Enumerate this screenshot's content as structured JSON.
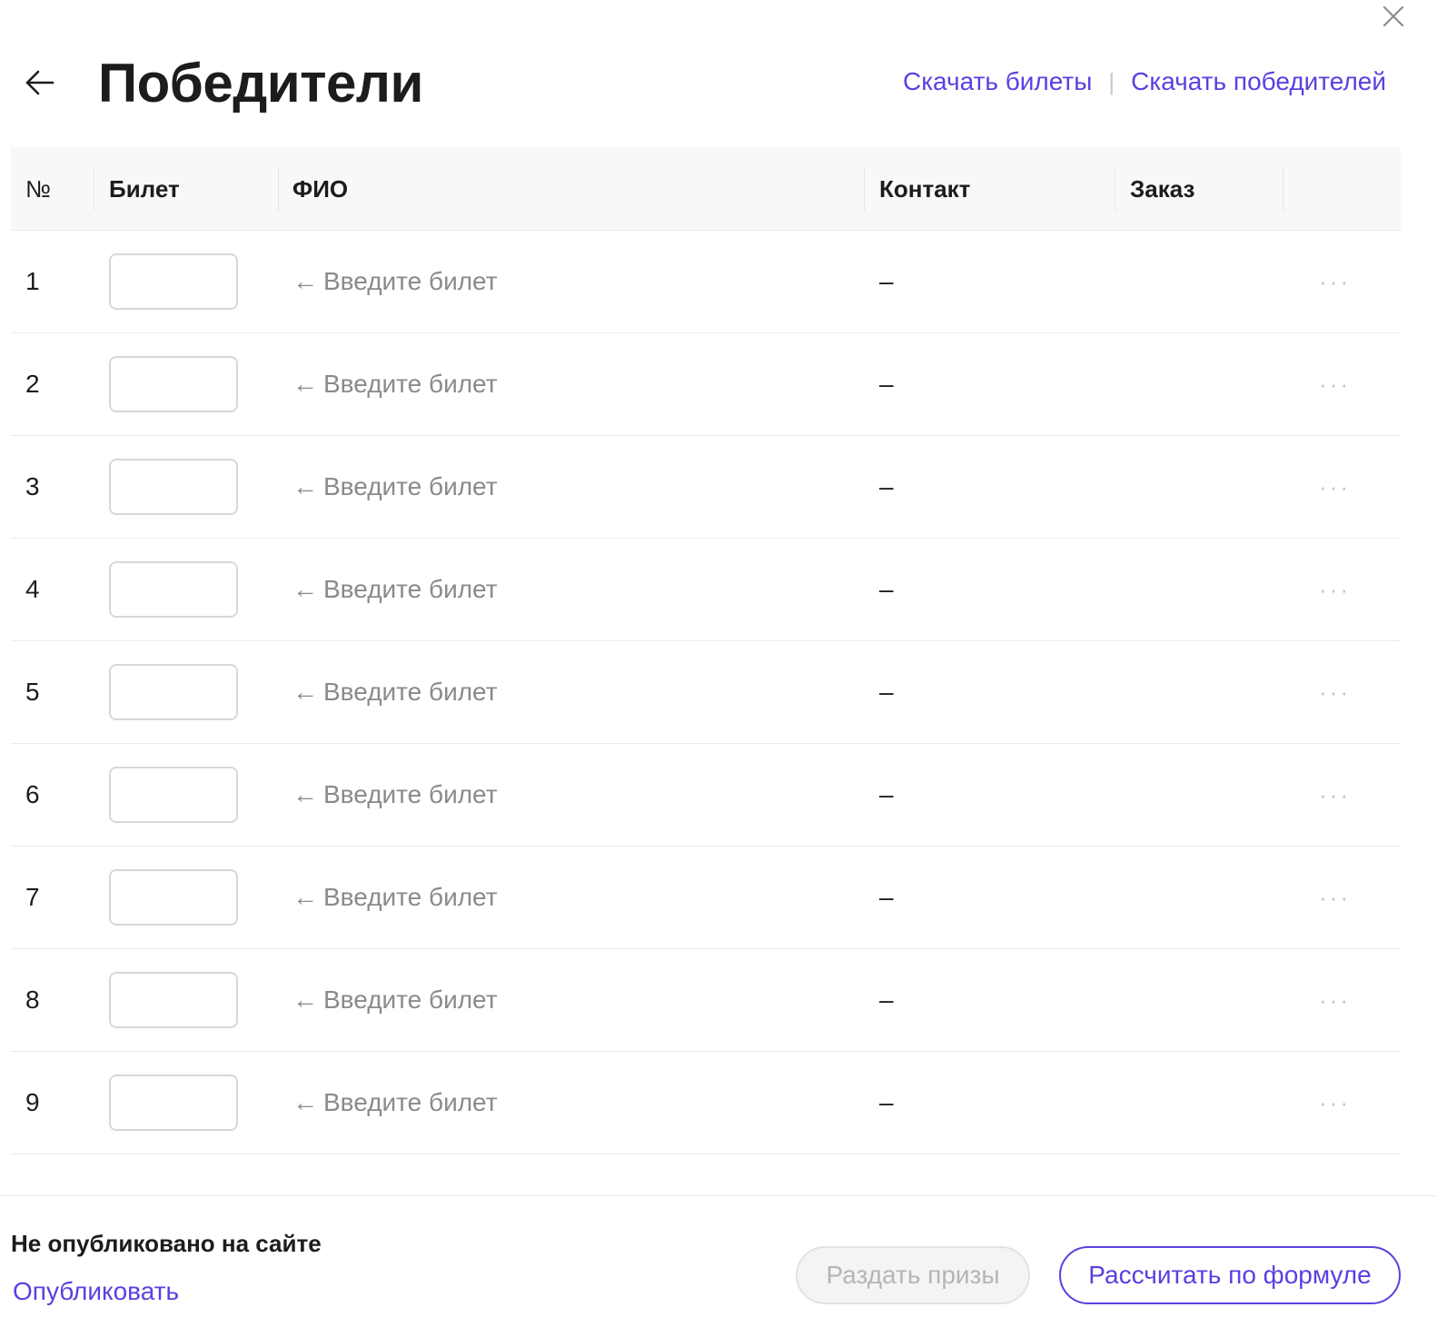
{
  "header": {
    "title": "Победители",
    "download_tickets": "Скачать билеты",
    "separator": "|",
    "download_winners": "Скачать победителей"
  },
  "table": {
    "columns": {
      "number": "№",
      "ticket": "Билет",
      "name": "ФИО",
      "contact": "Контакт",
      "order": "Заказ"
    },
    "rows": [
      {
        "number": "1",
        "ticket": "",
        "hint": "Введите билет",
        "contact": "–",
        "order": ""
      },
      {
        "number": "2",
        "ticket": "",
        "hint": "Введите билет",
        "contact": "–",
        "order": ""
      },
      {
        "number": "3",
        "ticket": "",
        "hint": "Введите билет",
        "contact": "–",
        "order": ""
      },
      {
        "number": "4",
        "ticket": "",
        "hint": "Введите билет",
        "contact": "–",
        "order": ""
      },
      {
        "number": "5",
        "ticket": "",
        "hint": "Введите билет",
        "contact": "–",
        "order": ""
      },
      {
        "number": "6",
        "ticket": "",
        "hint": "Введите билет",
        "contact": "–",
        "order": ""
      },
      {
        "number": "7",
        "ticket": "",
        "hint": "Введите билет",
        "contact": "–",
        "order": ""
      },
      {
        "number": "8",
        "ticket": "",
        "hint": "Введите билет",
        "contact": "–",
        "order": ""
      },
      {
        "number": "9",
        "ticket": "",
        "hint": "Введите билет",
        "contact": "–",
        "order": ""
      }
    ],
    "hint_arrow": "←",
    "more_glyph": "···"
  },
  "footer": {
    "status": "Не опубликовано на сайте",
    "publish_link": "Опубликовать",
    "distribute_button": "Раздать призы",
    "calculate_button": "Рассчитать по формуле"
  },
  "colors": {
    "accent": "#5b3fe0",
    "muted_text": "#8a8a8a",
    "border": "#ebebeb",
    "header_bg": "#f8f8f8"
  },
  "icons": {
    "close": "close-icon",
    "back": "arrow-left-icon",
    "more": "more-horizontal-icon"
  }
}
